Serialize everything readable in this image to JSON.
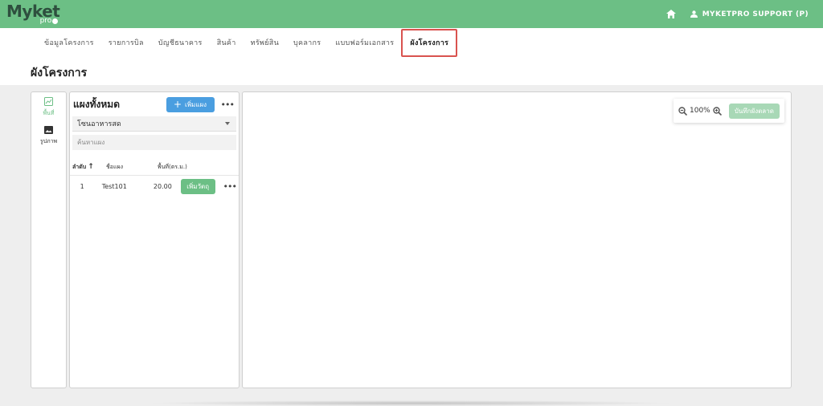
{
  "header": {
    "logo_main": "Myket",
    "logo_sub": "pro",
    "user_label": "MYKETPRO SUPPORT (P)",
    "colors": {
      "topbar": "#6cbf85",
      "accent_blue": "#4a9ee0",
      "highlight": "#d9534f"
    }
  },
  "nav": {
    "items": [
      {
        "label": "ข้อมูลโครงการ"
      },
      {
        "label": "รายการบิล"
      },
      {
        "label": "บัญชีธนาคาร"
      },
      {
        "label": "สินค้า"
      },
      {
        "label": "ทรัพย์สิน"
      },
      {
        "label": "บุคลากร"
      },
      {
        "label": "แบบฟอร์มเอกสาร"
      },
      {
        "label": "ผังโครงการ"
      }
    ],
    "active_index": 7
  },
  "page": {
    "title": "ผังโครงการ"
  },
  "tools": {
    "items": [
      {
        "label": "พื้นที่",
        "icon": "area-chart-icon"
      },
      {
        "label": "รูปภาพ",
        "icon": "image-icon"
      }
    ]
  },
  "list": {
    "title": "แผงทั้งหมด",
    "add_label": "เพิ่มแผง",
    "zone_value": "โซนอาหารสด",
    "search_placeholder": "ค้นหาแผง",
    "columns": [
      "ลำดับ",
      "ชื่อแผง",
      "พื้นที่(ตร.ม.)"
    ],
    "rows": [
      {
        "no": "1",
        "name": "Test101",
        "area": "20.00",
        "action": "เพิ่มวัตถุ"
      }
    ]
  },
  "canvas": {
    "zoom": "100%",
    "save_label": "บันทึกผังตลาด"
  }
}
